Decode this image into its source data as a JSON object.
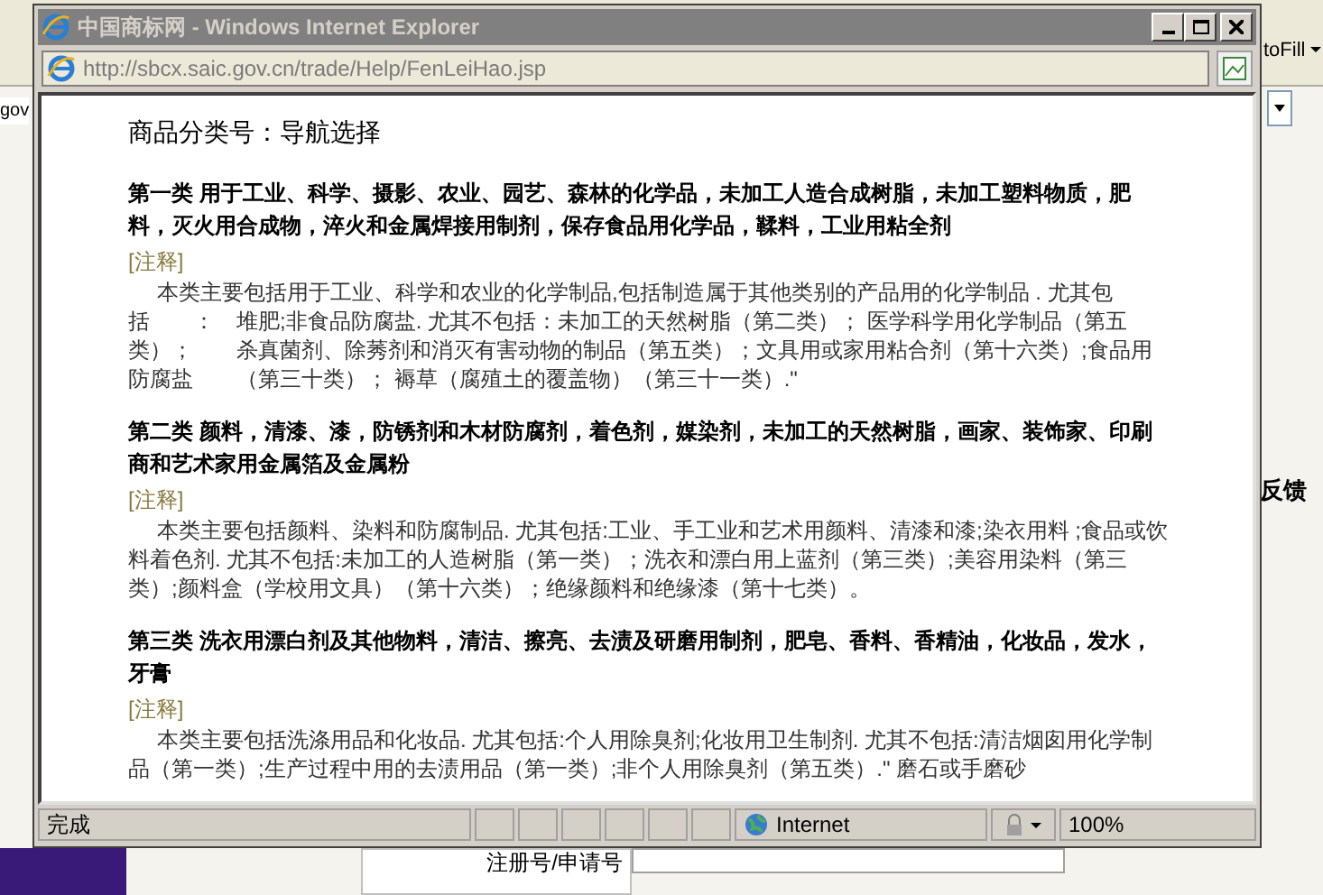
{
  "background": {
    "toolbar_text": "toFill",
    "address_text": "gov",
    "side_text": "反馈",
    "form_label": "注册号/申请号"
  },
  "window": {
    "title": "中国商标网 - Windows Internet Explorer",
    "url": "http://sbcx.saic.gov.cn/trade/Help/FenLeiHao.jsp"
  },
  "page": {
    "heading": "商品分类号：导航选择",
    "sections": [
      {
        "title": "第一类 用于工业、科学、摄影、农业、园艺、森林的化学品，未加工人造合成树脂，未加工塑料物质，肥料，灭火用合成物，淬火和金属焊接用制剂，保存食品用化学品，鞣料，工业用粘全剂",
        "note_label": "[注释]",
        "note": "本类主要包括用于工业、科学和农业的化学制品,包括制造属于其他类别的产品用的化学制品 . 尤其包括　　：　堆肥;非食品防腐盐. 尤其不包括：未加工的天然树脂（第二类）；  医学科学用化学制品（第五类）；　　杀真菌剂、除莠剂和消灭有害动物的制品（第五类）；文具用或家用粘合剂（第十六类）;食品用防腐盐　　（第三十类）；  褥草（腐殖土的覆盖物）（第三十一类）.\""
      },
      {
        "title": "第二类 颜料，清漆、漆，防锈剂和木材防腐剂，着色剂，媒染剂，未加工的天然树脂，画家、装饰家、印刷商和艺术家用金属箔及金属粉",
        "note_label": "[注释]",
        "note": "本类主要包括颜料、染料和防腐制品. 尤其包括:工业、手工业和艺术用颜料、清漆和漆;染衣用料 ;食品或饮料着色剂. 尤其不包括:未加工的人造树脂（第一类）；洗衣和漂白用上蓝剂（第三类）;美容用染料（第三类）;颜料盒（学校用文具）（第十六类）；绝缘颜料和绝缘漆（第十七类）。"
      },
      {
        "title": "第三类 洗衣用漂白剂及其他物料，清洁、擦亮、去渍及研磨用制剂，肥皂、香料、香精油，化妆品，发水，牙膏",
        "note_label": "[注释]",
        "note": "本类主要包括洗涤用品和化妆品. 尤其包括:个人用除臭剂;化妆用卫生制剂. 尤其不包括:清洁烟囱用化学制品（第一类）;生产过程中用的去渍用品（第一类）;非个人用除臭剂（第五类）.\" 磨石或手磨砂"
      }
    ]
  },
  "status_bar": {
    "text": "完成",
    "zone": "Internet",
    "zoom": "100%"
  }
}
